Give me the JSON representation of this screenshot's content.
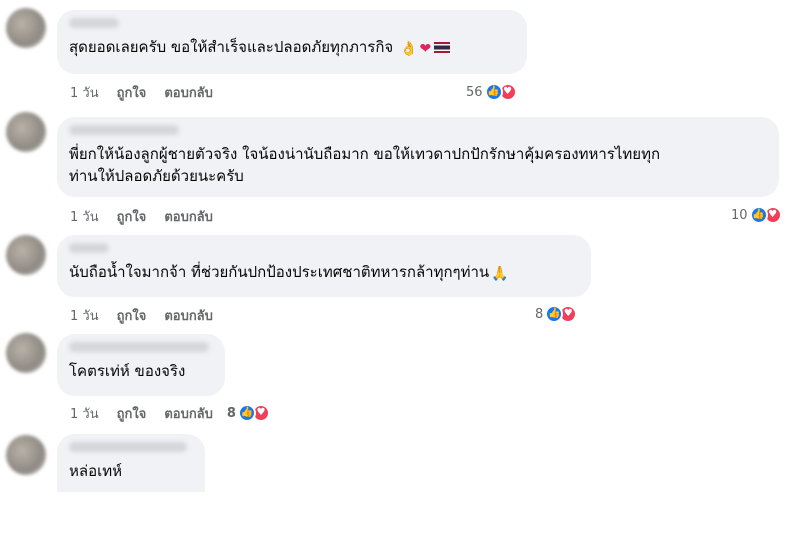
{
  "comments": [
    {
      "text": "สุดยอดเลยครับ ขอให้สำเร็จและปลอดภัยทุกภารกิจ",
      "emojis": [
        "👌",
        "❤"
      ],
      "time": "1 วัน",
      "like": "ถูกใจ",
      "reply": "ตอบกลับ",
      "reaction_count": "56"
    },
    {
      "text_line1": "พี่ยกให้น้องลูกผู้ชายตัวจริง ใจน้องน่านับถือมาก ขอให้เทวดาปกปักรักษาคุ้มครองทหารไทยทุก",
      "text_line2": "ท่านให้ปลอดภัยด้วยนะครับ",
      "time": "1 วัน",
      "like": "ถูกใจ",
      "reply": "ตอบกลับ",
      "reaction_count": "10"
    },
    {
      "text": "นับถือน้ำใจมากจ้า ที่ช่วยกันปกป้องประเทศชาติทหารกล้าทุกๆท่าน",
      "emojis": [
        "🙏"
      ],
      "time": "1 วัน",
      "like": "ถูกใจ",
      "reply": "ตอบกลับ",
      "reaction_count": "8"
    },
    {
      "text": "โคตรเท่ห์ ของจริง",
      "time": "1 วัน",
      "like": "ถูกใจ",
      "reply": "ตอบกลับ",
      "reaction_count": "8"
    },
    {
      "text": "หล่อเทห์"
    }
  ],
  "icons": {
    "like": "like-icon",
    "love": "love-icon"
  },
  "colors": {
    "like": "#1877f2",
    "love": "#f33e58",
    "bubble": "#f0f2f5",
    "meta": "#65676b"
  }
}
